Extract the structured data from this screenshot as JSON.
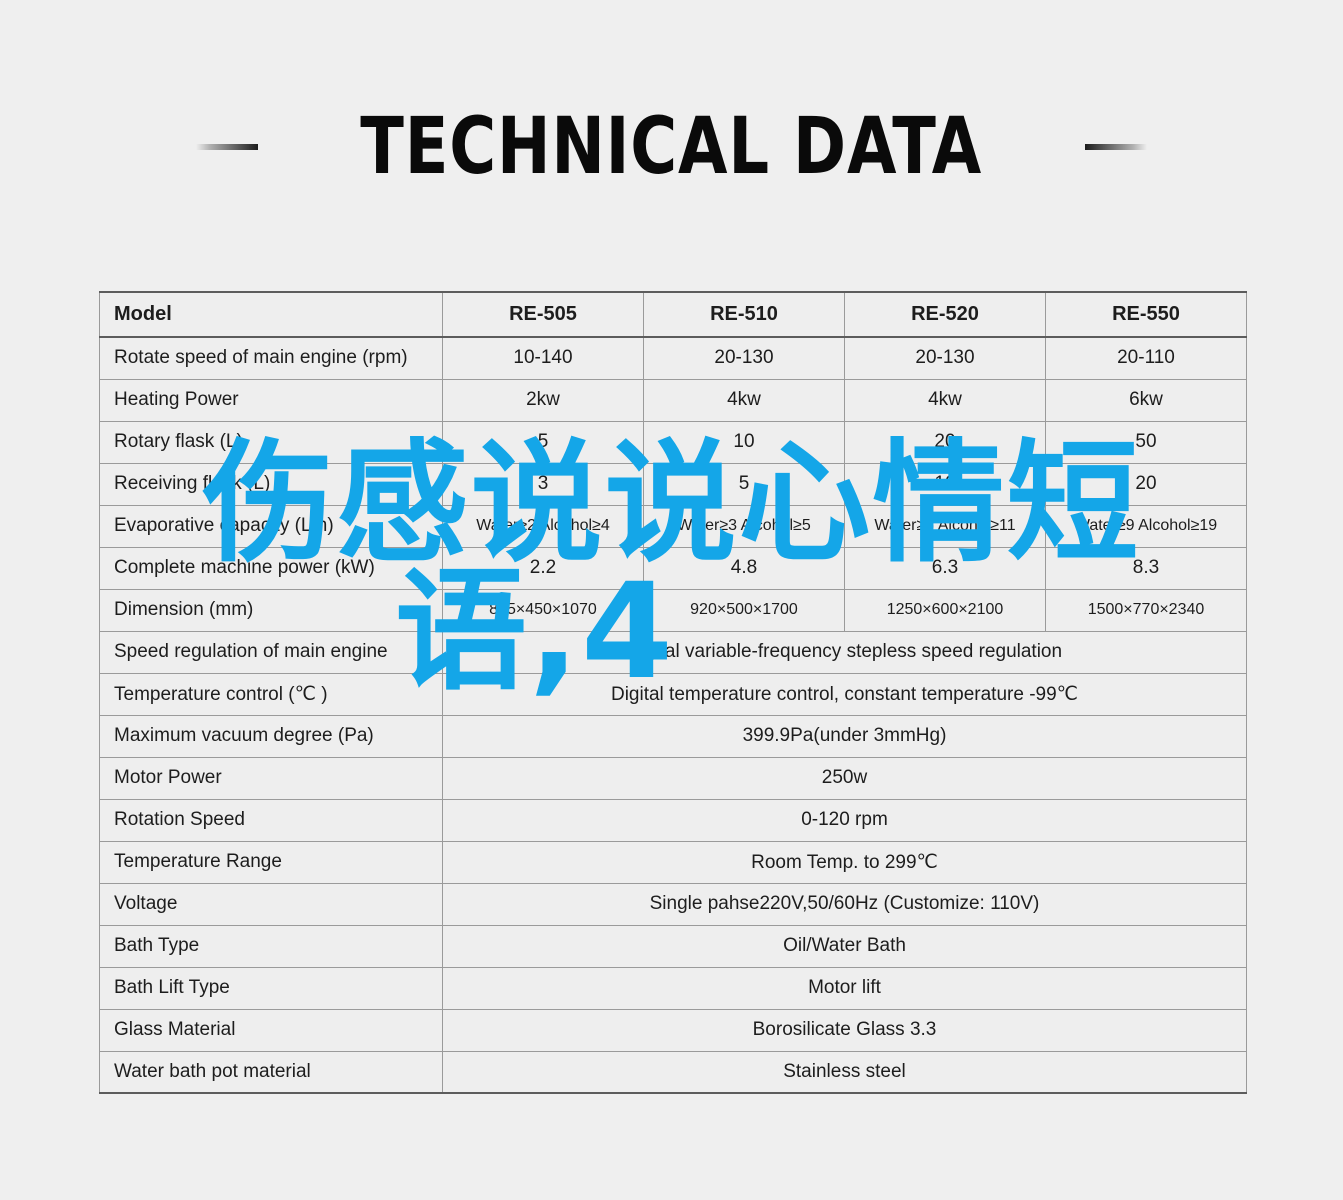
{
  "page": {
    "title": "TECHNICAL DATA",
    "background_color": "#efefef"
  },
  "watermark": {
    "line1": "伤感说说心情短",
    "line2": "语,4",
    "color": "#14a6e8"
  },
  "table": {
    "columns": [
      "Model",
      "RE-505",
      "RE-510",
      "RE-520",
      "RE-550"
    ],
    "rows": [
      {
        "label": "Rotate speed of main engine (rpm)",
        "values": [
          "10-140",
          "20-130",
          "20-130",
          "20-110"
        ]
      },
      {
        "label": "Heating Power",
        "values": [
          "2kw",
          "4kw",
          "4kw",
          "6kw"
        ]
      },
      {
        "label": "Rotary flask (L)",
        "values": [
          "5",
          "10",
          "20",
          "50"
        ]
      },
      {
        "label": "Receiving flask (L)",
        "values": [
          "3",
          "5",
          "10",
          "20"
        ]
      },
      {
        "label": "Evaporative capacity (L/h)",
        "values": [
          "Water≥2 Alcohol≥4",
          "Water≥3 Alcohol≥5",
          "Water≥5 Alcohol≥11",
          "Water≥9 Alcohol≥19"
        ]
      },
      {
        "label": "Complete machine power (kW)",
        "values": [
          "2.2",
          "4.8",
          "6.3",
          "8.3"
        ]
      },
      {
        "label": "Dimension (mm)",
        "values": [
          "865×450×1070",
          "920×500×1700",
          "1250×600×2100",
          "1500×770×2340"
        ]
      }
    ],
    "merged_rows": [
      {
        "label": "Speed regulation of main engine",
        "value": "Digital variable-frequency stepless speed regulation"
      },
      {
        "label": "Temperature control (℃ )",
        "value": "Digital temperature control, constant temperature -99℃"
      },
      {
        "label": "Maximum vacuum degree (Pa)",
        "value": "399.9Pa(under 3mmHg)"
      },
      {
        "label": "Motor Power",
        "value": "250w"
      },
      {
        "label": "Rotation Speed",
        "value": "0-120 rpm"
      },
      {
        "label": "Temperature Range",
        "value": "Room Temp. to 299℃"
      },
      {
        "label": "Voltage",
        "value": "Single pahse220V,50/60Hz (Customize: 110V)"
      },
      {
        "label": "Bath Type",
        "value": "Oil/Water Bath"
      },
      {
        "label": "Bath Lift Type",
        "value": "Motor lift"
      },
      {
        "label": "Glass Material",
        "value": "Borosilicate Glass 3.3"
      },
      {
        "label": "Water bath pot material",
        "value": "Stainless steel"
      }
    ]
  }
}
